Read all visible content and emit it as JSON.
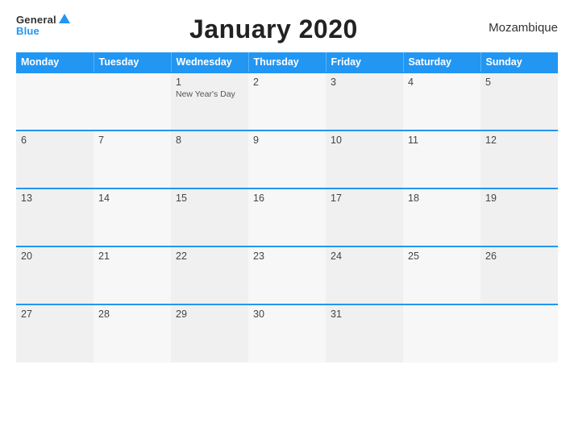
{
  "header": {
    "logo_general": "General",
    "logo_blue": "Blue",
    "title": "January 2020",
    "country": "Mozambique"
  },
  "weekdays": [
    "Monday",
    "Tuesday",
    "Wednesday",
    "Thursday",
    "Friday",
    "Saturday",
    "Sunday"
  ],
  "weeks": [
    [
      {
        "day": "",
        "event": ""
      },
      {
        "day": "",
        "event": ""
      },
      {
        "day": "1",
        "event": "New Year's Day"
      },
      {
        "day": "2",
        "event": ""
      },
      {
        "day": "3",
        "event": ""
      },
      {
        "day": "4",
        "event": ""
      },
      {
        "day": "5",
        "event": ""
      }
    ],
    [
      {
        "day": "6",
        "event": ""
      },
      {
        "day": "7",
        "event": ""
      },
      {
        "day": "8",
        "event": ""
      },
      {
        "day": "9",
        "event": ""
      },
      {
        "day": "10",
        "event": ""
      },
      {
        "day": "11",
        "event": ""
      },
      {
        "day": "12",
        "event": ""
      }
    ],
    [
      {
        "day": "13",
        "event": ""
      },
      {
        "day": "14",
        "event": ""
      },
      {
        "day": "15",
        "event": ""
      },
      {
        "day": "16",
        "event": ""
      },
      {
        "day": "17",
        "event": ""
      },
      {
        "day": "18",
        "event": ""
      },
      {
        "day": "19",
        "event": ""
      }
    ],
    [
      {
        "day": "20",
        "event": ""
      },
      {
        "day": "21",
        "event": ""
      },
      {
        "day": "22",
        "event": ""
      },
      {
        "day": "23",
        "event": ""
      },
      {
        "day": "24",
        "event": ""
      },
      {
        "day": "25",
        "event": ""
      },
      {
        "day": "26",
        "event": ""
      }
    ],
    [
      {
        "day": "27",
        "event": ""
      },
      {
        "day": "28",
        "event": ""
      },
      {
        "day": "29",
        "event": ""
      },
      {
        "day": "30",
        "event": ""
      },
      {
        "day": "31",
        "event": ""
      },
      {
        "day": "",
        "event": ""
      },
      {
        "day": "",
        "event": ""
      }
    ]
  ]
}
